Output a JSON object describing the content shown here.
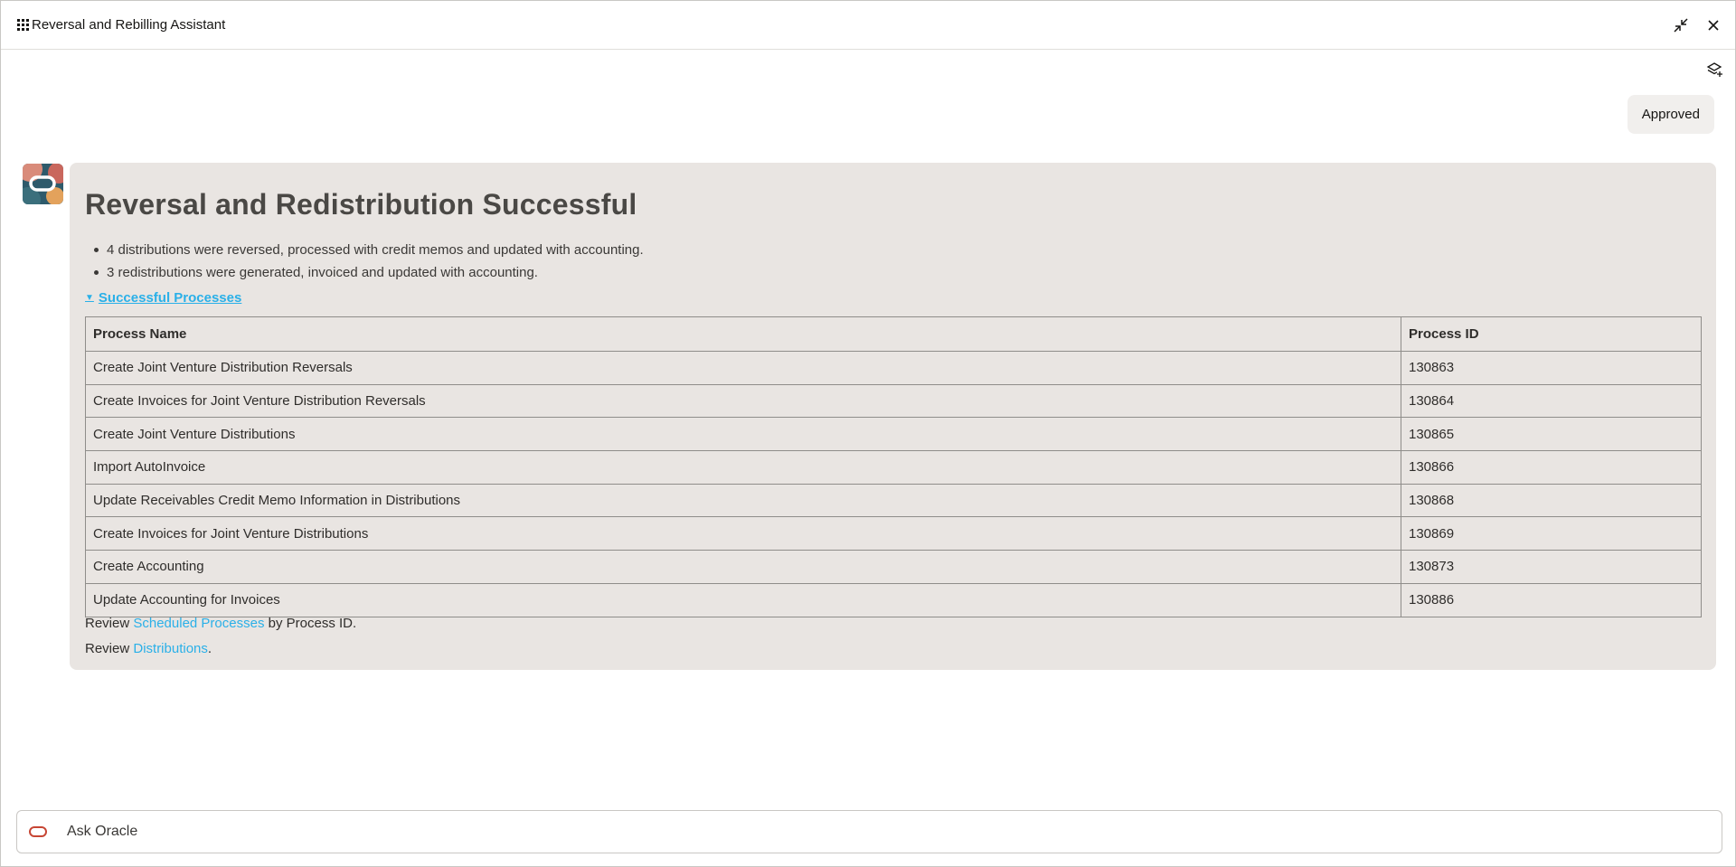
{
  "window": {
    "title": "Reversal and Rebilling Assistant"
  },
  "chat": {
    "user_message": "Approved",
    "bot": {
      "title": "Reversal and Redistribution Successful",
      "bullets": [
        "4 distributions were reversed, processed with credit memos and updated with accounting.",
        "3 redistributions were generated, invoiced and updated with accounting."
      ],
      "disclosure_label": "Successful Processes",
      "table": {
        "headers": [
          "Process Name",
          "Process ID"
        ],
        "rows": [
          [
            "Create Joint Venture Distribution Reversals",
            "130863"
          ],
          [
            "Create Invoices for Joint Venture Distribution Reversals",
            "130864"
          ],
          [
            "Create Joint Venture Distributions",
            "130865"
          ],
          [
            "Import AutoInvoice",
            "130866"
          ],
          [
            "Update Receivables Credit Memo Information in Distributions",
            "130868"
          ],
          [
            "Create Invoices for Joint Venture Distributions",
            "130869"
          ],
          [
            "Create Accounting",
            "130873"
          ],
          [
            "Update Accounting for Invoices",
            "130886"
          ]
        ]
      },
      "review1": {
        "prefix": "Review ",
        "link": "Scheduled Processes",
        "suffix": " by Process ID."
      },
      "review2": {
        "prefix": "Review ",
        "link": "Distributions",
        "suffix": "."
      }
    }
  },
  "input": {
    "placeholder": "Ask Oracle"
  },
  "colors": {
    "accent_link": "#2ab0e8",
    "card_bg": "#e9e5e2",
    "oracle_red": "#c74634"
  },
  "icons": [
    "app-grid-icon",
    "collapse-icon",
    "close-icon",
    "layers-add-icon",
    "assistant-avatar-icon",
    "oracle-logo-icon"
  ]
}
